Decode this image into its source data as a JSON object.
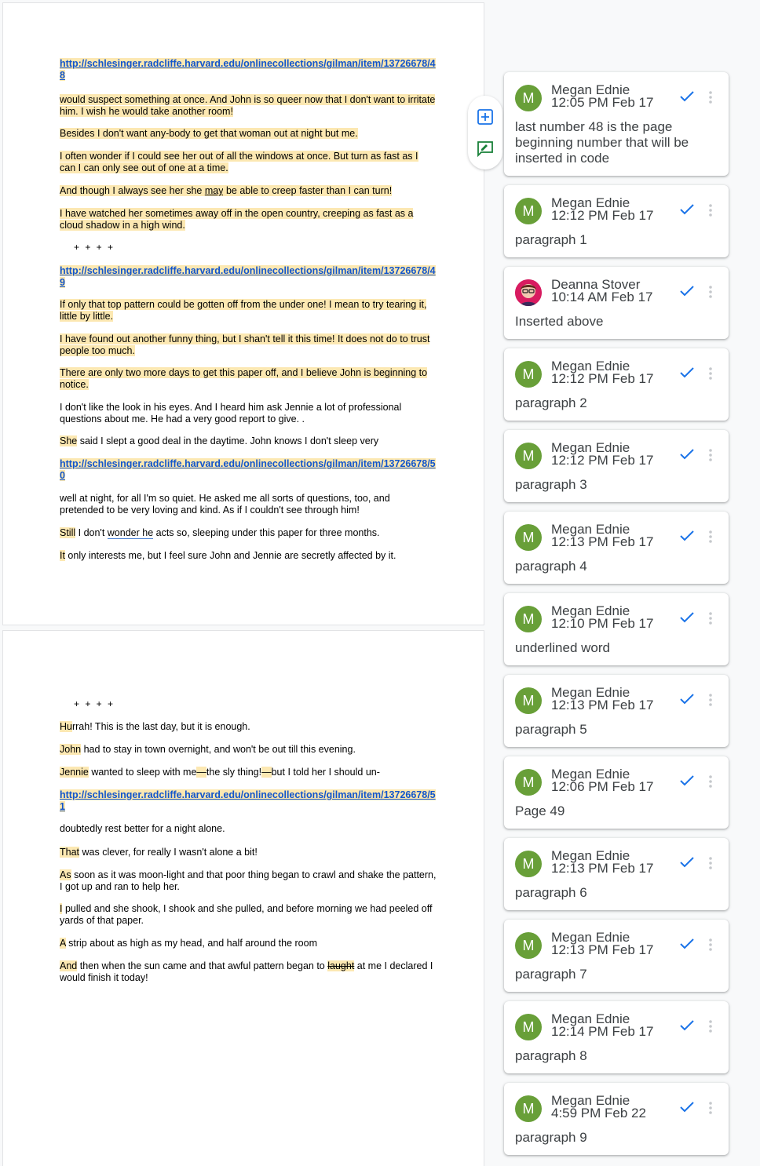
{
  "page1": {
    "link48": "http://schlesinger.radcliffe.harvard.edu/onlinecollections/gilman/item/13726678/48",
    "p1": "would suspect something at once. And John is so queer now that I don't want to irritate him. I wish he would take another room!",
    "p2": "Besides I don't want any-body to get that woman out at night but me.",
    "p3": "I often wonder if I could see her out of all the windows at once. But turn as fast as I can I can only see out of one at a time.",
    "p4_a": "And though I always see her she ",
    "p4_b": "may",
    "p4_c": " be able to creep faster than I can turn!",
    "p5": "I have watched her sometimes away off in the open country, creeping as fast as a cloud shadow in a high wind.",
    "stars": "+ + + +",
    "link49": "http://schlesinger.radcliffe.harvard.edu/onlinecollections/gilman/item/13726678/49",
    "p6": "If only that top pattern could be gotten off from the under one! I mean to try tearing it, little by little.",
    "p7": "I have found out another funny thing, but I shan't tell it this time! It does not do to trust people too much.",
    "p8": "There are only two more days to get this paper off, and I believe John is beginning to notice.",
    "p9": "I don't like the look in his eyes. And I heard him ask Jennie a lot of professional questions about me.    He had a very good report to give. .",
    "p10_a": "She",
    "p10_b": " said I slept a good deal in the daytime. John knows I don't sleep very",
    "link50": "http://schlesinger.radcliffe.harvard.edu/onlinecollections/gilman/item/13726678/50",
    "p11": "well at night, for all I'm so quiet.       He asked me all sorts of questions, too, and pretended to be very loving and kind. As if I couldn't see through him!",
    "p12_a": "Still",
    "p12_b": " I don't ",
    "p12_c": "wonder he",
    "p12_d": " acts so, sleeping under this paper for three months.",
    "p13_a": "It",
    "p13_b": " only interests me, but I feel sure John and Jennie are secretly affected by it."
  },
  "page2": {
    "stars": "+ + + +",
    "q1_a": "Hu",
    "q1_b": "rrah! This is the last day, but it is enough.",
    "q2_a": "John",
    "q2_b": " had to stay in town overnight, and won't be out till this evening.",
    "q3_a": "Jennie",
    "q3_b": " wanted to sleep with me",
    "q3_c": "—",
    "q3_d": "the sly thing!",
    "q3_e": "—",
    "q3_f": "but I told her I should un-",
    "link51": "http://schlesinger.radcliffe.harvard.edu/onlinecollections/gilman/item/13726678/51",
    "q4": "doubtedly rest better for a night alone.",
    "q5_a": "That",
    "q5_b": " was clever, for really I wasn't alone a bit!",
    "q6_a": "As",
    "q6_b": " soon as it was moon-light and that poor thing began to crawl and shake the pattern, I got up and ran to help her.",
    "q7_a": "I",
    "q7_b": " pulled and she shook, I shook and she pulled, and before morning we had peeled off yards of that paper.",
    "q8_a": "A",
    "q8_b": " strip about as high as my head, and half around the room",
    "q9_a": "And",
    "q9_b": " then when the sun came and that awful pattern began to ",
    "q9_c": "laught",
    "q9_d": " at me I declared I would finish it today!"
  },
  "comments": [
    {
      "initial": "M",
      "name": "Megan Ednie",
      "time": "12:05 PM Feb 17",
      "text": "last number 48 is the page beginning number that will be inserted in code"
    },
    {
      "initial": "M",
      "name": "Megan Ednie",
      "time": "12:12 PM Feb 17",
      "text": "paragraph 1"
    },
    {
      "initial": "",
      "name": "Deanna Stover",
      "time": "10:14 AM Feb 17",
      "text": "Inserted above"
    },
    {
      "initial": "M",
      "name": "Megan Ednie",
      "time": "12:12 PM Feb 17",
      "text": "paragraph 2"
    },
    {
      "initial": "M",
      "name": "Megan Ednie",
      "time": "12:12 PM Feb 17",
      "text": "paragraph 3"
    },
    {
      "initial": "M",
      "name": "Megan Ednie",
      "time": "12:13 PM Feb 17",
      "text": "paragraph 4"
    },
    {
      "initial": "M",
      "name": "Megan Ednie",
      "time": "12:10 PM Feb 17",
      "text": "underlined word"
    },
    {
      "initial": "M",
      "name": "Megan Ednie",
      "time": "12:13 PM Feb 17",
      "text": "paragraph 5"
    },
    {
      "initial": "M",
      "name": "Megan Ednie",
      "time": "12:06 PM Feb 17",
      "text": "Page 49"
    },
    {
      "initial": "M",
      "name": "Megan Ednie",
      "time": "12:13 PM Feb 17",
      "text": "paragraph 6"
    },
    {
      "initial": "M",
      "name": "Megan Ednie",
      "time": "12:13 PM Feb 17",
      "text": "paragraph 7"
    },
    {
      "initial": "M",
      "name": "Megan Ednie",
      "time": "12:14 PM Feb 17",
      "text": "paragraph 8"
    },
    {
      "initial": "M",
      "name": "Megan Ednie",
      "time": "4:59 PM Feb 22",
      "text": "paragraph 9"
    }
  ],
  "icons": {
    "add_comment": "add-comment-icon",
    "suggest_edit": "suggest-edit-icon",
    "resolve": "check-icon",
    "more": "more-vert-icon"
  },
  "colors": {
    "highlight": "#fce8b2",
    "link": "#1155cc",
    "accent": "#1a73e8",
    "avatar": "#689f38"
  }
}
